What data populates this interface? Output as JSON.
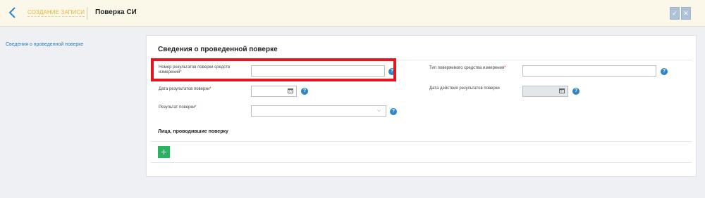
{
  "header": {
    "back_icon": "chevron-left-icon",
    "breadcrumb": "СОЗДАНИЕ ЗАПИСИ",
    "title": "Поверка СИ",
    "save_icon": "check-icon",
    "close_icon": "close-icon"
  },
  "sidebar": {
    "items": [
      {
        "label": "Сведения о проведенной поверке"
      }
    ]
  },
  "form": {
    "title": "Сведения о проведенной поверке",
    "fields": {
      "result_number": {
        "label": "Номер результатов поверки средств измерений",
        "value": ""
      },
      "instrument_type": {
        "label": "Тип поверяемого средства измерения",
        "value": ""
      },
      "result_date": {
        "label": "Дата результатов поверки",
        "value": ""
      },
      "validity_date": {
        "label": "Дата действия результатов поверки",
        "value": ""
      },
      "result": {
        "label": "Результат поверки",
        "value": ""
      }
    },
    "required_mark": "*",
    "help_glyph": "?",
    "persons_section": {
      "title": "Лица, проводившие поверку",
      "add_glyph": "+"
    }
  },
  "colors": {
    "accent": "#2e86c9",
    "header_bg": "#fbf8ea",
    "breadcrumb": "#e6b43a",
    "add_button": "#27b560",
    "highlight": "#e8141d",
    "required": "#d9342b"
  }
}
